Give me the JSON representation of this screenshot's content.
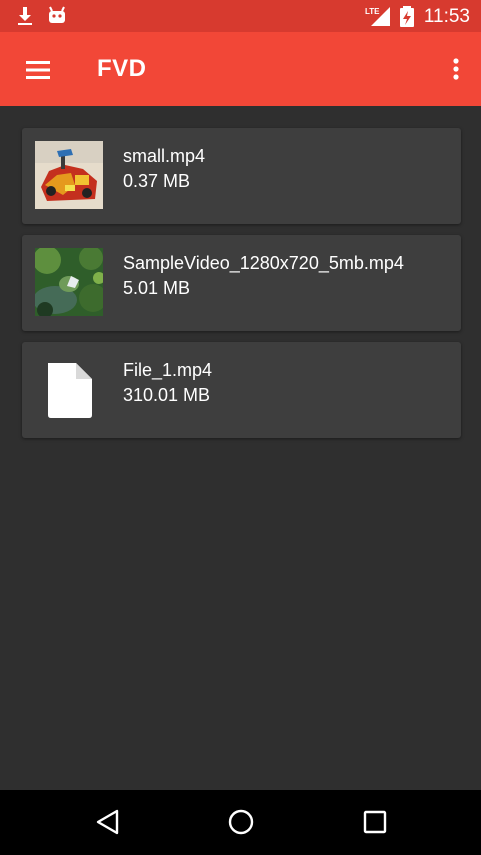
{
  "status_bar": {
    "time": "11:53",
    "network_label": "LTE",
    "icons": [
      "download-icon",
      "android-icon",
      "lte-signal-icon",
      "battery-charging-icon"
    ]
  },
  "app_bar": {
    "title": "FVD",
    "menu_icon": "hamburger-menu-icon",
    "overflow_icon": "more-vert-icon",
    "color": "#f24737"
  },
  "files": [
    {
      "name": "small.mp4",
      "size": "0.37 MB",
      "thumbnail": "video-thumbnail-toy"
    },
    {
      "name": "SampleVideo_1280x720_5mb.mp4",
      "size": "5.01 MB",
      "thumbnail": "video-thumbnail-garden"
    },
    {
      "name": "File_1.mp4",
      "size": "310.01 MB",
      "thumbnail": "file-icon"
    }
  ],
  "nav_bar": {
    "buttons": [
      "back-icon",
      "home-icon",
      "recents-icon"
    ]
  }
}
